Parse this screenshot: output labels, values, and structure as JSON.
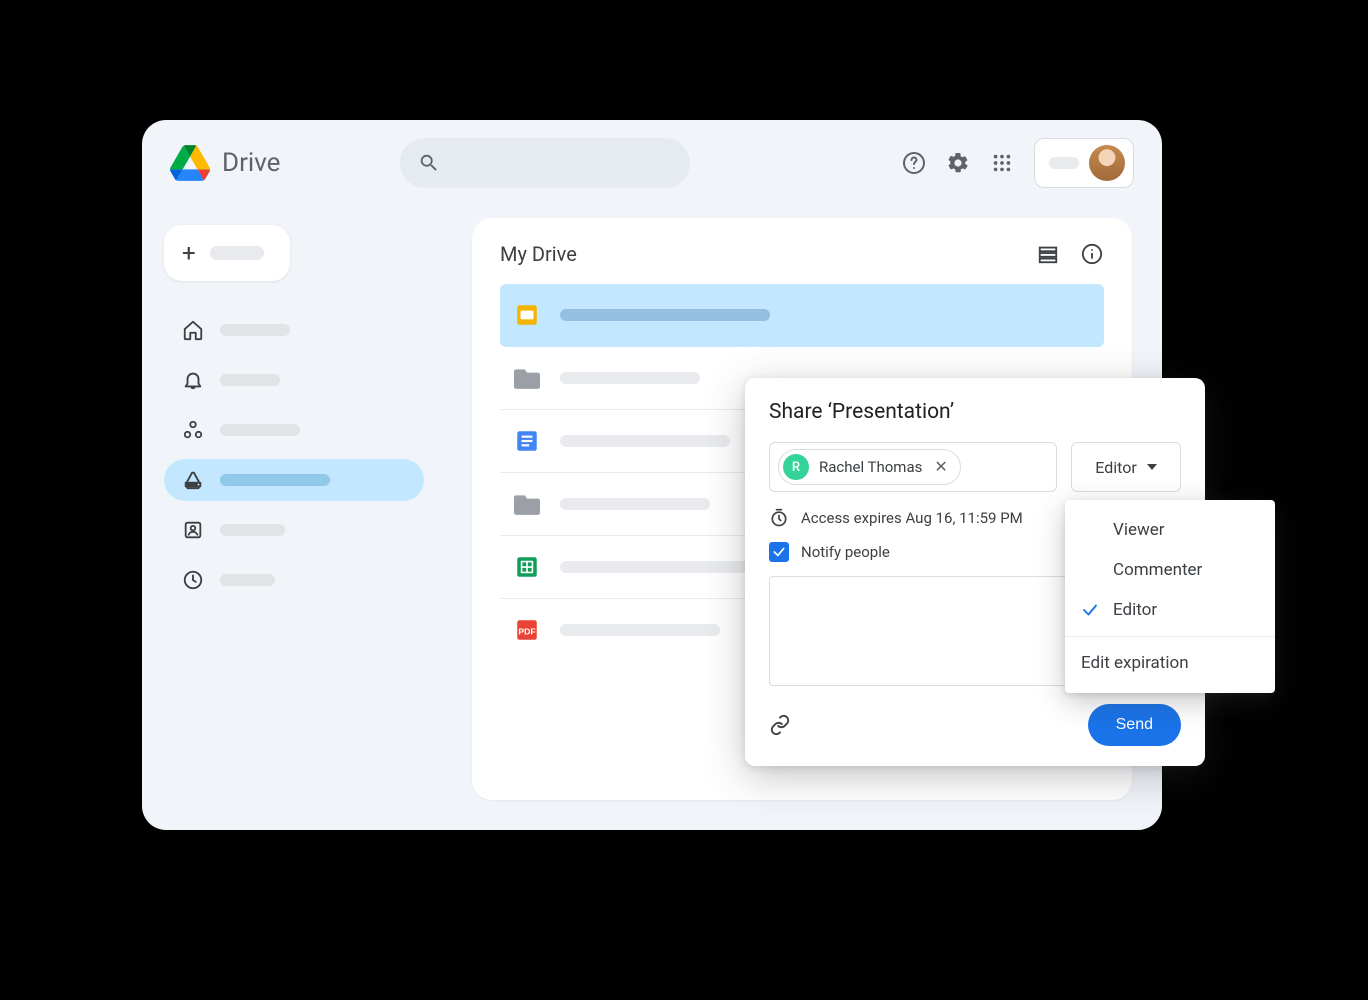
{
  "app": {
    "title": "Drive"
  },
  "main": {
    "title": "My Drive"
  },
  "share": {
    "title": "Share ‘Presentation’",
    "person_name": "Rachel Thomas",
    "person_initial": "R",
    "role_selected": "Editor",
    "expiry_text": "Access expires Aug 16, 11:59 PM",
    "notify_label": "Notify people",
    "notify_checked": true,
    "send_label": "Send"
  },
  "role_menu": {
    "options": [
      {
        "label": "Viewer",
        "selected": false
      },
      {
        "label": "Commenter",
        "selected": false
      },
      {
        "label": "Editor",
        "selected": true
      }
    ],
    "extra": "Edit expiration"
  },
  "files": [
    {
      "type": "slides",
      "selected": true
    },
    {
      "type": "folder"
    },
    {
      "type": "docs"
    },
    {
      "type": "folder"
    },
    {
      "type": "sheets"
    },
    {
      "type": "pdf"
    }
  ],
  "sidebar": {
    "items": [
      {
        "icon": "home"
      },
      {
        "icon": "bell"
      },
      {
        "icon": "shared"
      },
      {
        "icon": "drive",
        "selected": true
      },
      {
        "icon": "contacts"
      },
      {
        "icon": "recent"
      }
    ]
  }
}
